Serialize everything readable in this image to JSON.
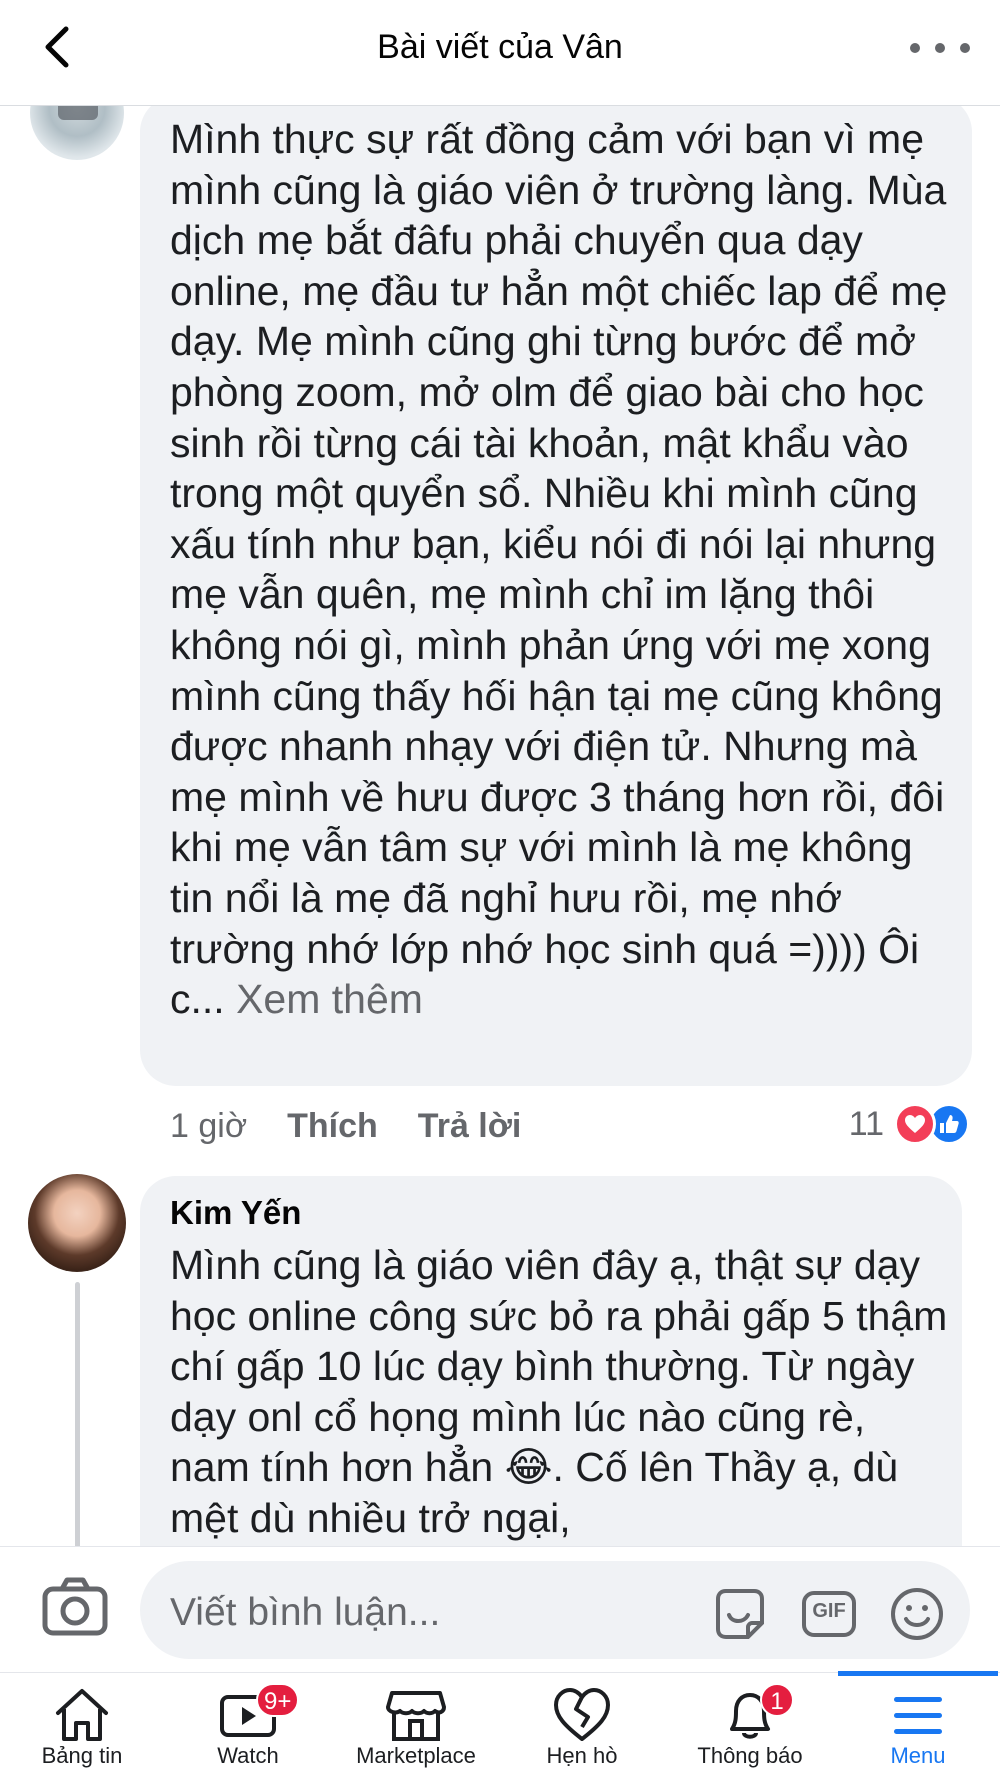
{
  "header": {
    "title": "Bài viết của Vân"
  },
  "comments": [
    {
      "author": "",
      "text": "Mình thực sự rất đồng cảm với bạn vì mẹ mình cũng là giáo viên ở trường làng. Mùa dịch mẹ bắt đâfu phải chuyển qua dạy online, mẹ đầu tư hẳn một chiếc lap để mẹ dạy. Mẹ mình cũng ghi từng bước để mở phòng zoom, mở olm để giao bài cho học sinh rồi từng cái tài khoản, mật khẩu vào trong một quyển sổ. Nhiều khi mình cũng xấu tính như bạn, kiểu nói đi nói lại nhưng mẹ vẫn quên, mẹ mình chỉ im lặng thôi không nói gì, mình phản ứng với mẹ xong mình cũng thấy hối hận tại mẹ cũng không được nhanh nhạy với điện tử. Nhưng mà mẹ mình về hưu được 3 tháng hơn rồi, đôi khi mẹ vẫn tâm sự với mình là mẹ không tin nổi là mẹ đã nghỉ hưu rồi, mẹ nhớ trường nhớ lớp nhớ học sinh quá =)))) Ôi c...",
      "see_more": " Xem thêm",
      "time": "1 giờ",
      "like_label": "Thích",
      "reply_label": "Trả lời",
      "reaction_count": "11"
    },
    {
      "author": "Kim Yến",
      "text": "Mình cũng là giáo viên đây ạ, thật sự dạy học online công sức bỏ ra phải gấp 5 thậm chí gấp 10 lúc dạy bình thường. Từ ngày dạy onl cổ họng mình lúc nào cũng rè, nam tính hơn hẳn 😂. Cố lên Thầy ạ, dù mệt dù nhiều trở ngại,"
    }
  ],
  "composer": {
    "placeholder": "Viết bình luận...",
    "gif_label": "GIF"
  },
  "nav": {
    "items": [
      {
        "label": "Bảng tin",
        "icon": "home-icon"
      },
      {
        "label": "Watch",
        "icon": "watch-icon",
        "badge": "9+"
      },
      {
        "label": "Marketplace",
        "icon": "marketplace-icon"
      },
      {
        "label": "Hẹn hò",
        "icon": "dating-heart-icon"
      },
      {
        "label": "Thông báo",
        "icon": "bell-icon",
        "badge": "1"
      },
      {
        "label": "Menu",
        "icon": "menu-icon",
        "active": true
      }
    ]
  },
  "colors": {
    "accent": "#1877f2",
    "badge": "#e41e3f",
    "bubble": "#f0f2f5",
    "secondary_text": "#65676b"
  }
}
